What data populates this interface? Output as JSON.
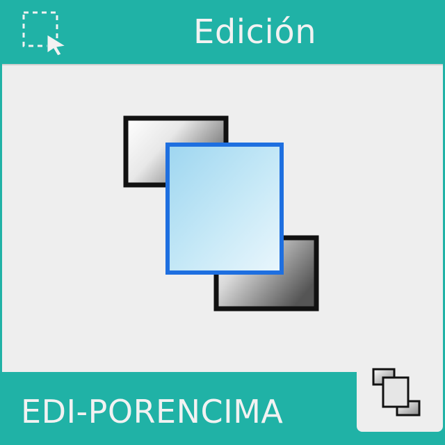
{
  "header": {
    "title": "Edición",
    "select_icon": "selection-cursor-icon"
  },
  "main": {
    "icon": "bring-to-front-icon"
  },
  "footer": {
    "label": "EDI-PORENCIMA",
    "corner_icon": "bring-to-front-small-icon"
  },
  "colors": {
    "accent": "#20B2A6",
    "panel": "#EEEEEE",
    "selected_fill": "#A8DDF3",
    "selected_border": "#1E6FE0",
    "text_light": "#F2F2F2"
  }
}
